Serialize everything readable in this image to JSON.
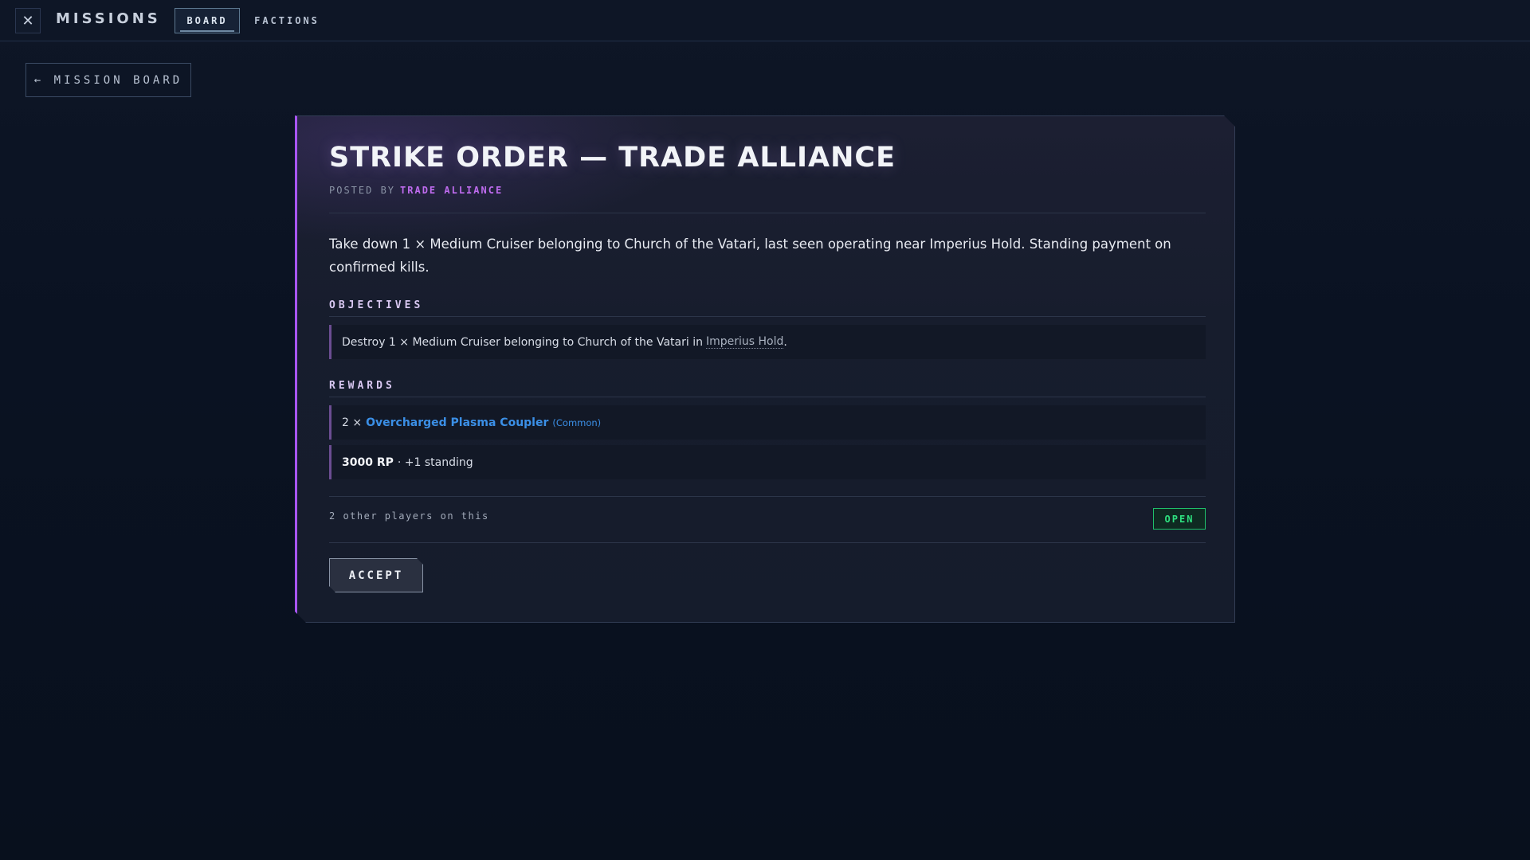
{
  "topbar": {
    "close_glyph": "✕",
    "title": "MISSIONS",
    "tabs": [
      {
        "label": "BOARD",
        "active": true
      },
      {
        "label": "FACTIONS",
        "active": false
      }
    ]
  },
  "back_button": {
    "label": "← MISSION BOARD"
  },
  "mission": {
    "title": "STRIKE ORDER — TRADE ALLIANCE",
    "posted_by_label": "POSTED BY",
    "posted_by_faction": "TRADE ALLIANCE",
    "description": "Take down 1 × Medium Cruiser belonging to Church of the Vatari, last seen operating near Imperius Hold. Standing payment on confirmed kills.",
    "objectives_title": "OBJECTIVES",
    "objectives": [
      {
        "text": "Destroy 1 × Medium Cruiser belonging to Church of the Vatari in",
        "location": "Imperius Hold",
        "suffix": "."
      }
    ],
    "rewards_title": "REWARDS",
    "rewards": {
      "item_quantity": "2 ×",
      "item_name": "Overcharged Plasma Coupler",
      "item_rarity": "(Common)",
      "rp_amount": "3000 RP",
      "rp_rest": "· +1 standing"
    },
    "other_players": "2 other players on this",
    "status": "OPEN",
    "accept_label": "ACCEPT"
  },
  "colors": {
    "accent_purple": "#a855f7",
    "faction_text": "#c06cf0",
    "item_link": "#3b8fe6",
    "status_green": "#2ee07f",
    "background": "#0b1322"
  }
}
